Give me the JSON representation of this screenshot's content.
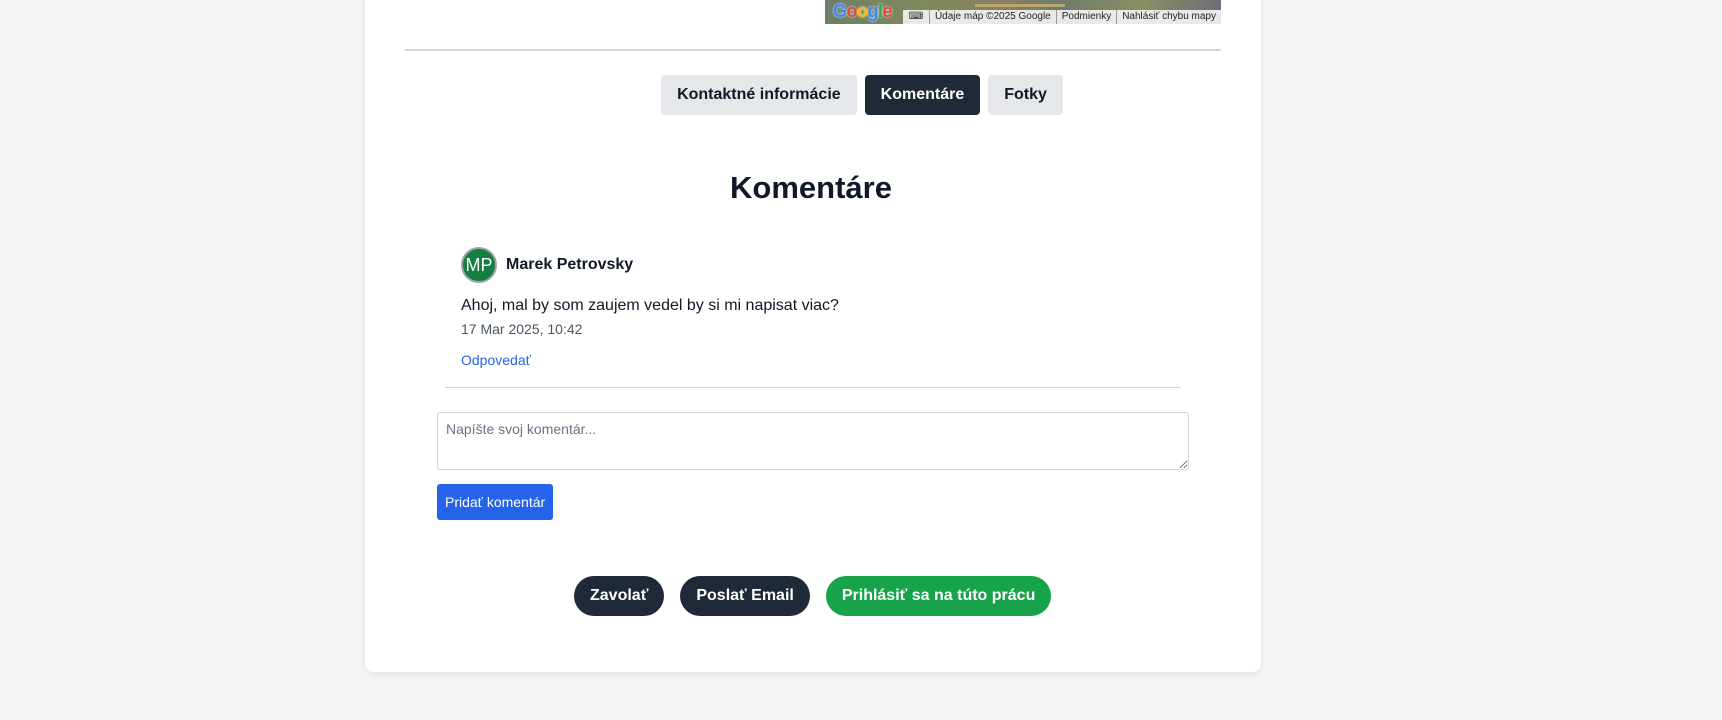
{
  "map": {
    "logo": "Google",
    "keyboard_icon": "keyboard-icon",
    "attribution": [
      "Údaje máp ©2025 Google",
      "Podmienky",
      "Nahlásiť chybu mapy"
    ]
  },
  "tabs": [
    {
      "label": "Kontaktné informácie",
      "active": false
    },
    {
      "label": "Komentáre",
      "active": true
    },
    {
      "label": "Fotky",
      "active": false
    }
  ],
  "section": {
    "title": "Komentáre"
  },
  "comments": [
    {
      "initials": "MP",
      "author": "Marek Petrovsky",
      "text": "Ahoj, mal by som zaujem vedel by si mi napisat viac?",
      "time": "17 Mar 2025, 10:42",
      "reply_label": "Odpovedať"
    }
  ],
  "comment_form": {
    "placeholder": "Napíšte svoj komentár...",
    "value": "",
    "submit_label": "Pridať komentár"
  },
  "actions": {
    "call_label": "Zavolať",
    "email_label": "Poslať Email",
    "apply_label": "Prihlásiť sa na túto prácu"
  },
  "colors": {
    "primary_dark": "#1f2937",
    "accent_blue": "#2563eb",
    "accent_green": "#16a34a",
    "avatar_green": "#15803d",
    "page_bg": "#f3f4f6"
  }
}
